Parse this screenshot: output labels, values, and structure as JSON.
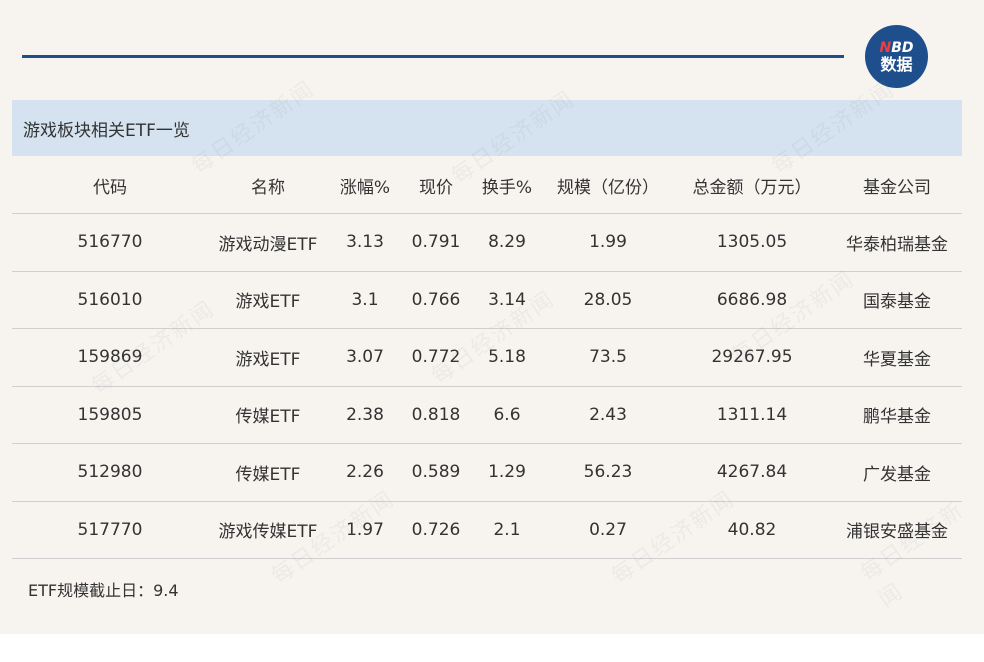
{
  "header": {
    "logo_line1": "NBD",
    "logo_line2": "数据"
  },
  "table": {
    "title": "游戏板块相关ETF一览",
    "columns": [
      "代码",
      "名称",
      "涨幅%",
      "现价",
      "换手%",
      "规模（亿份）",
      "总金额（万元）",
      "基金公司"
    ],
    "rows": [
      [
        "516770",
        "游戏动漫ETF",
        "3.13",
        "0.791",
        "8.29",
        "1.99",
        "1305.05",
        "华泰柏瑞基金"
      ],
      [
        "516010",
        "游戏ETF",
        "3.1",
        "0.766",
        "3.14",
        "28.05",
        "6686.98",
        "国泰基金"
      ],
      [
        "159869",
        "游戏ETF",
        "3.07",
        "0.772",
        "5.18",
        "73.5",
        "29267.95",
        "华夏基金"
      ],
      [
        "159805",
        "传媒ETF",
        "2.38",
        "0.818",
        "6.6",
        "2.43",
        "1311.14",
        "鹏华基金"
      ],
      [
        "512980",
        "传媒ETF",
        "2.26",
        "0.589",
        "1.29",
        "56.23",
        "4267.84",
        "广发基金"
      ],
      [
        "517770",
        "游戏传媒ETF",
        "1.97",
        "0.726",
        "2.1",
        "0.27",
        "40.82",
        "浦银安盛基金"
      ]
    ]
  },
  "footnote": "ETF规模截止日：9.4",
  "watermark": "每日经济新闻",
  "colors": {
    "brand_blue": "#1f4e8c",
    "title_bar_bg": "#d4e3ef",
    "page_bg": "#f7f4f0"
  }
}
